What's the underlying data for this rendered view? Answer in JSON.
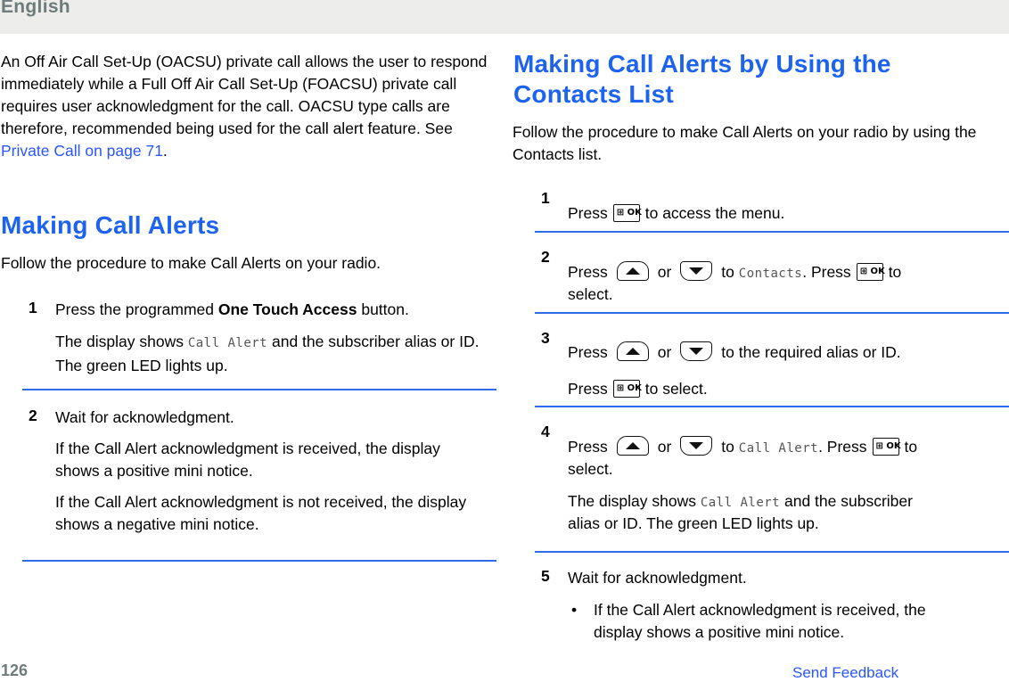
{
  "header": {
    "title": "English"
  },
  "left": {
    "intro": {
      "text": "An Off Air Call Set-Up (OACSU) private call allows the user to respond immediately while a Full Off Air Call Set-Up (FOACSU) private call requires user acknowledgment for the call. OACSU type calls are therefore, recommended being used for the call alert feature. See ",
      "link": "Private Call on page 71",
      "end": "."
    },
    "section_title": "Making Call Alerts",
    "section_intro": "Follow the procedure to make Call Alerts on your radio.",
    "steps": [
      {
        "number": "1",
        "text_pre": "Press the programmed ",
        "text_bold": "One Touch Access",
        "text_post": " button.",
        "result_pre": "The display shows ",
        "result_mono": "Call Alert",
        "result_post": " and the subscriber alias or ID. The green LED lights up."
      },
      {
        "number": "2",
        "text": "Wait for acknowledgment.",
        "para1": "If the Call Alert acknowledgment is received, the display shows a positive mini notice.",
        "para2": "If the Call Alert acknowledgment is not received, the display shows a negative mini notice."
      }
    ]
  },
  "right": {
    "section_title": "Making Call Alerts by Using the Contacts List",
    "section_intro": "Follow the procedure to make Call Alerts on your radio by using the Contacts list.",
    "steps": [
      {
        "number": "1",
        "press": "Press",
        "post": "to access the menu."
      },
      {
        "number": "2",
        "press": "Press",
        "or": "or",
        "to": "to",
        "mono": "Contacts",
        "press2": ". Press",
        "post": "to",
        "line2": "select."
      },
      {
        "number": "3",
        "press": "Press",
        "or": "or",
        "post": "to the required alias or ID.",
        "press2": "Press",
        "post2": "to select."
      },
      {
        "number": "4",
        "press": "Press",
        "or": "or",
        "to": "to",
        "mono": "Call Alert",
        "press2": ". Press",
        "post": "to",
        "line2": "select.",
        "result_pre": "The display shows ",
        "result_mono": "Call Alert",
        "result_post": " and the subscriber",
        "result_line2": "alias or ID. The green LED lights up."
      },
      {
        "number": "5",
        "text": "Wait for acknowledgment.",
        "bullet": "•",
        "bullet_text1": "If the Call Alert acknowledgment is received, the",
        "bullet_text2": "display shows a positive mini notice."
      }
    ]
  },
  "icons": {
    "ok_key_label": "⊞ OK",
    "menu_ok": "menu-ok-key-icon",
    "up": "arrow-up-key-icon",
    "down": "arrow-down-key-icon"
  },
  "footer": {
    "page_number": "126",
    "feedback": "Send Feedback"
  }
}
